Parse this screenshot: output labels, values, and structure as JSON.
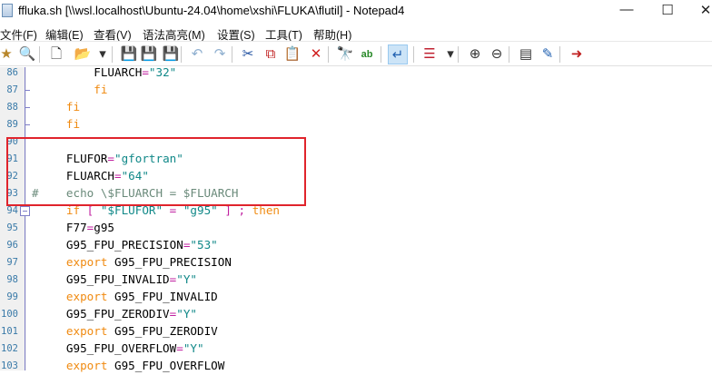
{
  "window": {
    "title": "ffluka.sh [\\\\wsl.localhost\\Ubuntu-24.04\\home\\xshi\\FLUKA\\flutil] - Notepad4",
    "minimize": "—",
    "maximize": "☐",
    "close": "✕"
  },
  "menu": [
    "文件(F)",
    "编辑(E)",
    "查看(V)",
    "语法高亮(M)",
    "设置(S)",
    "工具(T)",
    "帮助(H)"
  ],
  "toolbar": [
    {
      "icon": "favorites-icon",
      "glyph": "★",
      "color": "#b8862a"
    },
    {
      "icon": "browse-folder-icon",
      "glyph": "🔍",
      "color": "#c09040"
    },
    {
      "icon": "new-file-icon",
      "glyph": "🗋",
      "color": "#333"
    },
    {
      "icon": "open-file-icon",
      "glyph": "📂",
      "color": "#d9a640"
    },
    {
      "icon": "dropdown-icon",
      "glyph": "▾",
      "color": "#333"
    },
    {
      "icon": "save-icon-disabled",
      "glyph": "💾",
      "color": "#a8c0d8"
    },
    {
      "icon": "save-icon",
      "glyph": "💾",
      "color": "#2060a0"
    },
    {
      "icon": "save-all-icon",
      "glyph": "💾",
      "color": "#2060a0"
    },
    {
      "icon": "undo-icon",
      "glyph": "↶",
      "color": "#90b0d0"
    },
    {
      "icon": "redo-icon",
      "glyph": "↷",
      "color": "#90b0d0"
    },
    {
      "icon": "cut-icon",
      "glyph": "✂",
      "color": "#2050a0"
    },
    {
      "icon": "copy-icon",
      "glyph": "⧉",
      "color": "#c02020"
    },
    {
      "icon": "paste-icon",
      "glyph": "📋",
      "color": "#a08050"
    },
    {
      "icon": "delete-icon",
      "glyph": "✕",
      "color": "#d02020"
    },
    {
      "icon": "find-icon",
      "glyph": "🔭",
      "color": "#2060b0"
    },
    {
      "icon": "replace-icon",
      "glyph": "ab",
      "color": "#2a8a2a"
    },
    {
      "icon": "word-wrap-icon",
      "glyph": "↵",
      "color": "#2060b0"
    },
    {
      "icon": "list-icon",
      "glyph": "☰",
      "color": "#c02030"
    },
    {
      "icon": "dropdown-icon",
      "glyph": "▾",
      "color": "#333"
    },
    {
      "icon": "zoom-in-icon",
      "glyph": "⊕",
      "color": "#333"
    },
    {
      "icon": "zoom-out-icon",
      "glyph": "⊖",
      "color": "#333"
    },
    {
      "icon": "scheme-icon",
      "glyph": "▤",
      "color": "#333"
    },
    {
      "icon": "customize-scheme-icon",
      "glyph": "✎",
      "color": "#2060b0"
    },
    {
      "icon": "exit-icon",
      "glyph": "➜",
      "color": "#c02020"
    }
  ],
  "lines": [
    {
      "n": "86",
      "t": [
        [
          "         FLUARCH",
          "var"
        ],
        [
          "=",
          "op"
        ],
        [
          "\"32\"",
          "str"
        ]
      ]
    },
    {
      "n": "87",
      "fold": "tick",
      "t": [
        [
          "         ",
          "var"
        ],
        [
          "fi",
          "kw"
        ]
      ]
    },
    {
      "n": "88",
      "fold": "tick",
      "t": [
        [
          "     ",
          "var"
        ],
        [
          "fi",
          "kw"
        ]
      ]
    },
    {
      "n": "89",
      "fold": "tick",
      "t": [
        [
          "     ",
          "var"
        ],
        [
          "fi",
          "kw"
        ]
      ]
    },
    {
      "n": "90",
      "t": []
    },
    {
      "n": "91",
      "t": [
        [
          "     FLUFOR",
          "var"
        ],
        [
          "=",
          "op"
        ],
        [
          "\"gfortran\"",
          "str"
        ]
      ]
    },
    {
      "n": "92",
      "t": [
        [
          "     FLUARCH",
          "var"
        ],
        [
          "=",
          "op"
        ],
        [
          "\"64\"",
          "str"
        ]
      ]
    },
    {
      "n": "93",
      "t": [
        [
          "#    echo \\$FLUARCH = $FLUARCH",
          "cm"
        ]
      ]
    },
    {
      "n": "94",
      "fold": "box",
      "t": [
        [
          "     ",
          "var"
        ],
        [
          "if",
          "kw"
        ],
        [
          " [ ",
          "op"
        ],
        [
          "\"$FLUFOR\"",
          "str"
        ],
        [
          " = ",
          "op"
        ],
        [
          "\"g95\"",
          "str"
        ],
        [
          " ] ; ",
          "op"
        ],
        [
          "then",
          "kw"
        ]
      ]
    },
    {
      "n": "95",
      "t": [
        [
          "     F77",
          "var"
        ],
        [
          "=",
          "op"
        ],
        [
          "g95",
          "var"
        ]
      ]
    },
    {
      "n": "96",
      "t": [
        [
          "     G95_FPU_PRECISION",
          "var"
        ],
        [
          "=",
          "op"
        ],
        [
          "\"53\"",
          "str"
        ]
      ]
    },
    {
      "n": "97",
      "t": [
        [
          "     ",
          "var"
        ],
        [
          "export",
          "kw"
        ],
        [
          " G95_FPU_PRECISION",
          "var"
        ]
      ]
    },
    {
      "n": "98",
      "t": [
        [
          "     G95_FPU_INVALID",
          "var"
        ],
        [
          "=",
          "op"
        ],
        [
          "\"Y\"",
          "str"
        ]
      ]
    },
    {
      "n": "99",
      "t": [
        [
          "     ",
          "var"
        ],
        [
          "export",
          "kw"
        ],
        [
          " G95_FPU_INVALID",
          "var"
        ]
      ]
    },
    {
      "n": "100",
      "t": [
        [
          "     G95_FPU_ZERODIV",
          "var"
        ],
        [
          "=",
          "op"
        ],
        [
          "\"Y\"",
          "str"
        ]
      ]
    },
    {
      "n": "101",
      "t": [
        [
          "     ",
          "var"
        ],
        [
          "export",
          "kw"
        ],
        [
          " G95_FPU_ZERODIV",
          "var"
        ]
      ]
    },
    {
      "n": "102",
      "t": [
        [
          "     G95_FPU_OVERFLOW",
          "var"
        ],
        [
          "=",
          "op"
        ],
        [
          "\"Y\"",
          "str"
        ]
      ]
    },
    {
      "n": "103",
      "t": [
        [
          "     ",
          "var"
        ],
        [
          "export",
          "kw"
        ],
        [
          " G95_FPU_OVERFLOW",
          "var"
        ]
      ]
    }
  ],
  "colors": {
    "keyword": "#f08a10",
    "string": "#108888",
    "operator": "#c020a0",
    "comment": "#6a8a7a",
    "highlight_box": "#e0242c",
    "line_number": "#3a7aa8"
  }
}
